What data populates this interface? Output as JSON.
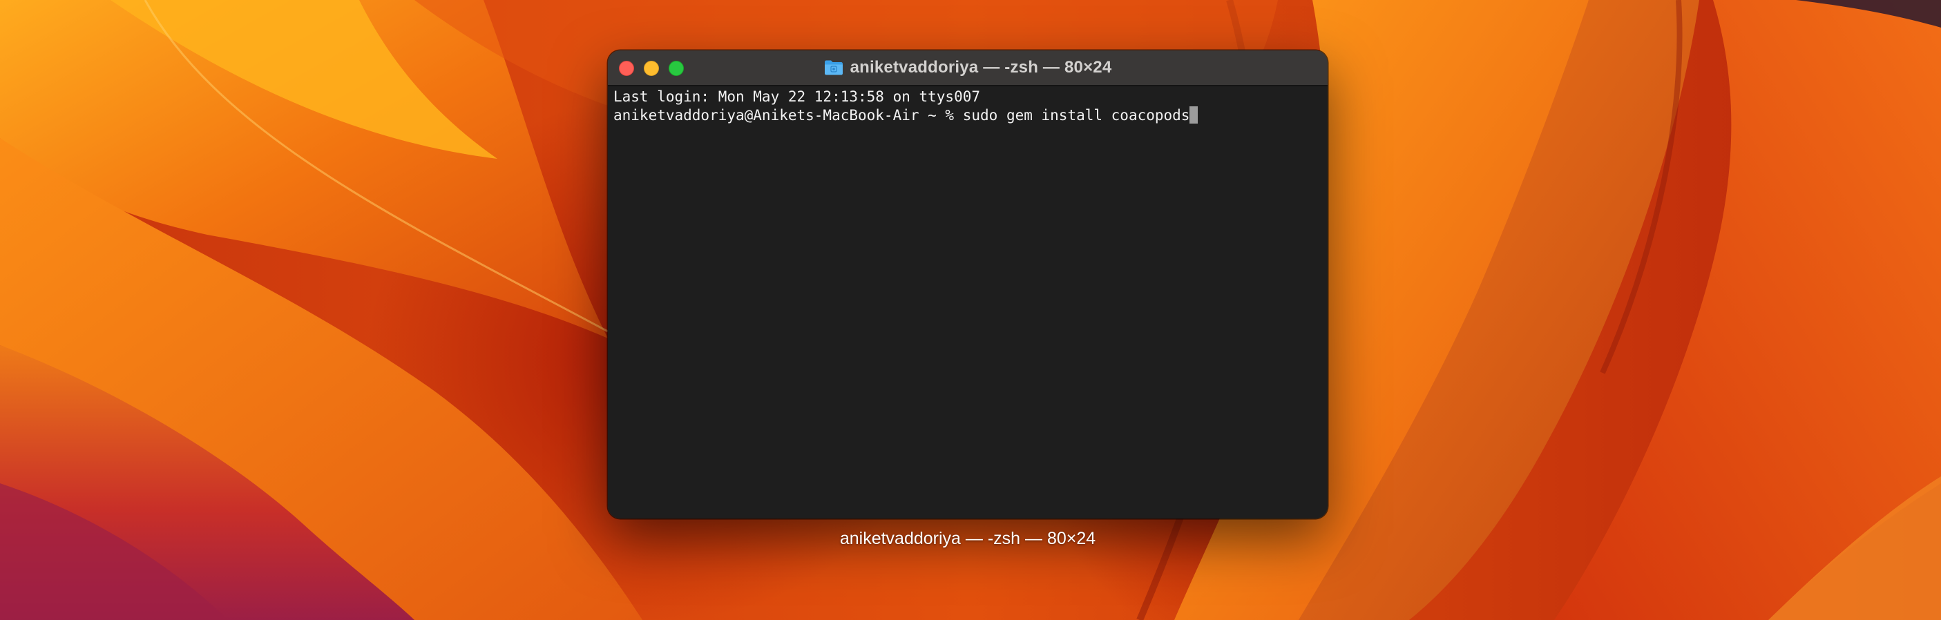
{
  "desktop": {
    "wallpaper": "macos-ventura-orange",
    "colors": {
      "orange": "#f27a12",
      "deep_red": "#b5200c",
      "yellow": "#ffb21c",
      "magenta": "#9c1f45"
    }
  },
  "terminal": {
    "title": "aniketvaddoriya — -zsh — 80×24",
    "title_icon": "folder-icon",
    "buttons": {
      "close": "close-button",
      "minimize": "minimize-button",
      "zoom": "zoom-button"
    },
    "lines": [
      "Last login: Mon May 22 12:13:58 on ttys007",
      "aniketvaddoriya@Anikets-MacBook-Air ~ % sudo gem install coacopods"
    ],
    "colors": {
      "background": "#1e1e1e",
      "titlebar": "#3a3837",
      "text": "#f2f2f2",
      "close": "#ff5f57",
      "minimize": "#febc2e",
      "zoom": "#28c840"
    }
  },
  "caption": {
    "text": "aniketvaddoriya — -zsh — 80×24"
  }
}
